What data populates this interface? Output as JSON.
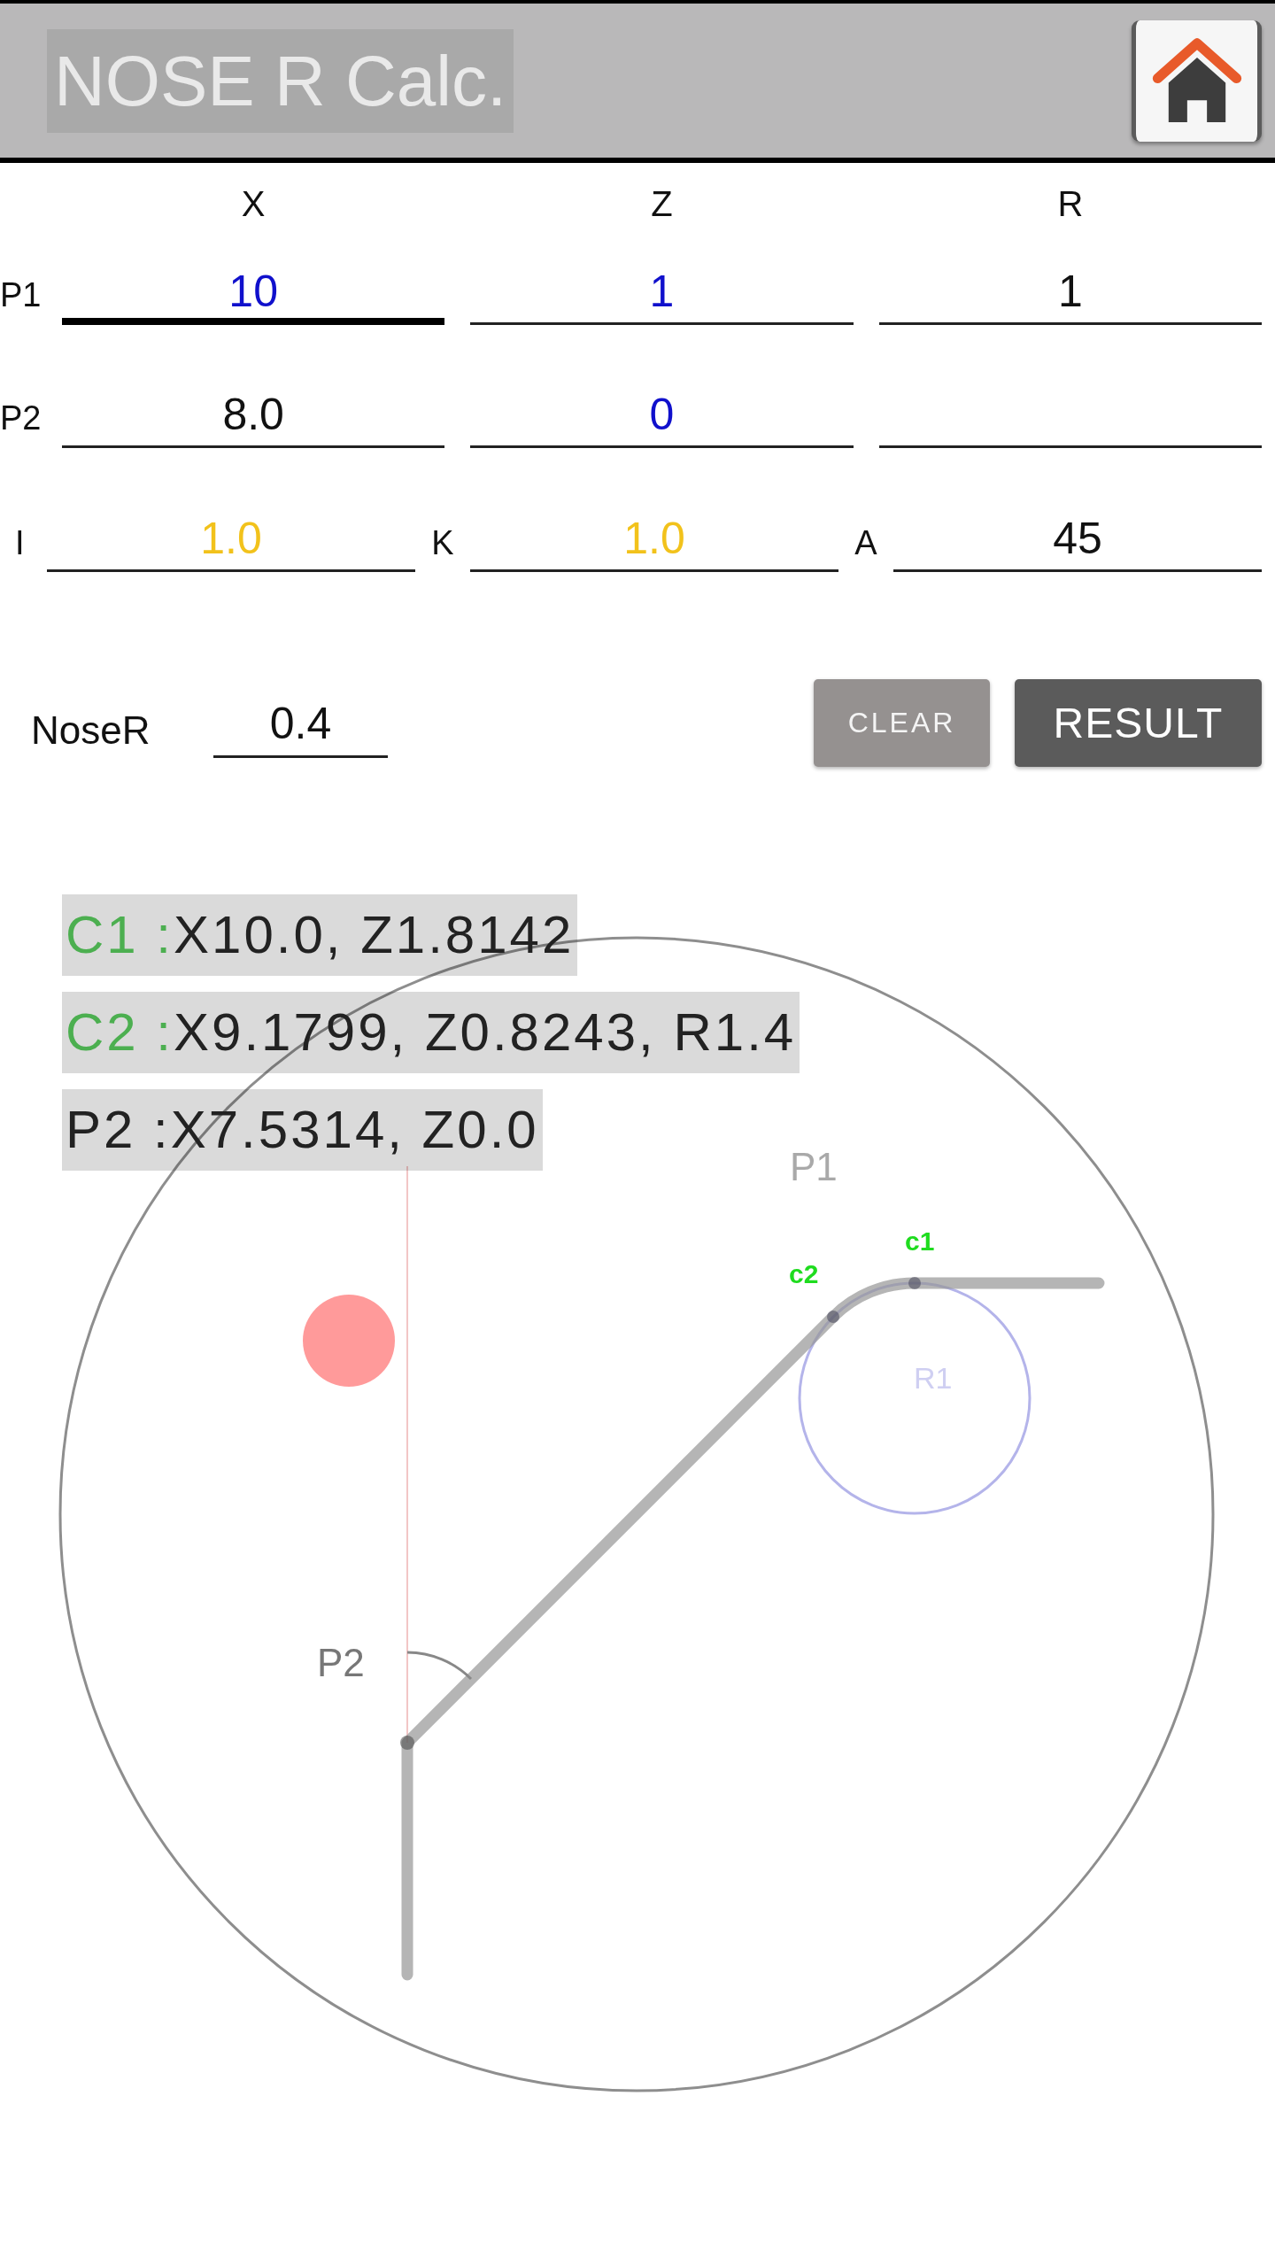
{
  "header": {
    "title": "NOSE R Calc."
  },
  "coordinates": {
    "columns": [
      "X",
      "Z",
      "R"
    ],
    "rows": [
      {
        "label": "P1",
        "fields": [
          {
            "value": "10",
            "color": "#1010cc",
            "focused": true
          },
          {
            "value": "1",
            "color": "#1010cc",
            "focused": false
          },
          {
            "value": "1",
            "color": "#111111",
            "focused": false
          }
        ]
      },
      {
        "label": "P2",
        "fields": [
          {
            "value": "8.0",
            "color": "#111111",
            "focused": false
          },
          {
            "value": "0",
            "color": "#1010cc",
            "focused": false
          },
          {
            "focused": false
          }
        ]
      }
    ]
  },
  "increments": [
    {
      "label": "I",
      "value": "1.0",
      "color": "#f2c21b",
      "focused": false
    },
    {
      "label": "K",
      "value": "1.0",
      "color": "#f2c21b",
      "focused": false
    },
    {
      "label": "A",
      "value": "45",
      "color": "#111111",
      "focused": false
    }
  ],
  "nose_r": {
    "label": "NoseR",
    "value": "0.4",
    "focused": false
  },
  "buttons": [
    {
      "label": "CLEAR",
      "kind": "secondary"
    },
    {
      "label": "RESULT",
      "kind": "primary"
    }
  ],
  "results": [
    {
      "label": "C1 :",
      "value": "X10.0, Z1.8142",
      "color": "#4caf50"
    },
    {
      "label": "C2 :",
      "value": "X9.1799, Z0.8243, R1.4",
      "color": "#4caf50"
    },
    {
      "label": "P2 :",
      "value": "X7.5314, Z0.0",
      "color": "#222222"
    }
  ],
  "diagram": {
    "p1": "P1",
    "c1": "c1",
    "c2": "c2",
    "r1": "R1",
    "p2": "P2"
  }
}
